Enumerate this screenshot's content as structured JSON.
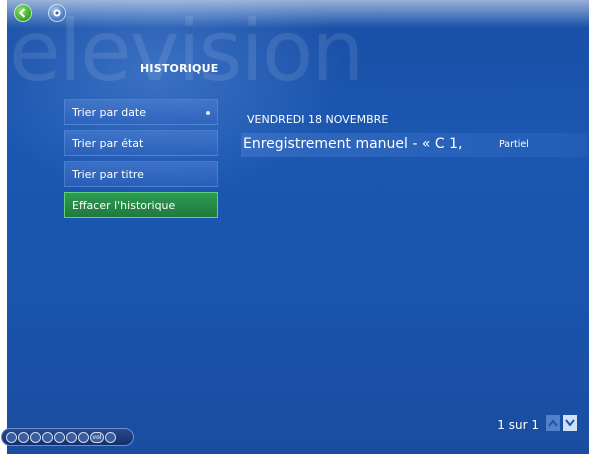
{
  "watermark": "elevision",
  "header": {
    "title": "HISTORIQUE"
  },
  "topbar": {
    "back_icon": "back-arrow-icon",
    "start_icon": "windows-media-center-icon"
  },
  "menu": {
    "items": [
      {
        "label": "Trier par date",
        "selected": true
      },
      {
        "label": "Trier par état"
      },
      {
        "label": "Trier par titre"
      },
      {
        "label": "Effacer l'historique",
        "focused": true
      }
    ]
  },
  "list": {
    "date_header": "VENDREDI 18 NOVEMBRE",
    "rows": [
      {
        "title": "Enregistrement manuel - « C 1,",
        "status": "Partiel"
      }
    ]
  },
  "pager": {
    "text": "1 sur 1"
  },
  "colors": {
    "background": "#1a55ae",
    "focus": "#2e9a52"
  },
  "transport": {
    "vol_label": "vol"
  }
}
